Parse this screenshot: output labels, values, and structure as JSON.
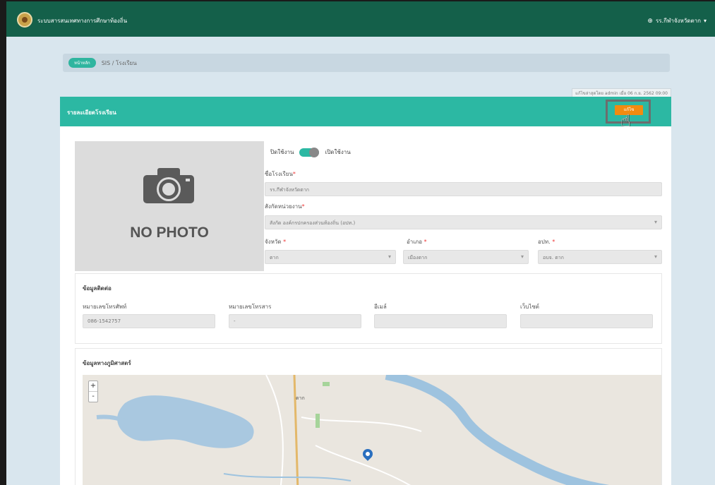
{
  "navbar": {
    "brand": "ระบบสารสนเทศทางการศึกษาท้องถิ่น",
    "user": "รร.กีฬาจังหวัดตาก",
    "caret": "▾",
    "globe": "⊕"
  },
  "breadcrumb": {
    "badge": "หน้าหลัก",
    "path": "SIS / โรงเรียน"
  },
  "last_updated": "แก้ไขล่าสุดโดย admin เมื่อ 06 ก.ย. 2562 09:00",
  "panel": {
    "title": "รายละเอียดโรงเรียน",
    "edit_button": "แก้ไข"
  },
  "photo": {
    "placeholder": "NO PHOTO"
  },
  "toggle": {
    "off_label": "ปิดใช้งาน",
    "on_label": "เปิดใช้งาน",
    "state": "on"
  },
  "form": {
    "school_name_label": "ชื่อโรงเรียน",
    "school_name_value": "รร.กีฬาจังหวัดตาก",
    "agency_label": "สังกัดหน่วยงาน",
    "agency_value": "สังกัด องค์กรปกครองส่วนท้องถิ่น (อปท.)",
    "province_label": "จังหวัด",
    "province_value": "ตาก",
    "district_label": "อำเภอ",
    "district_value": "เมืองตาก",
    "org_label": "อปท.",
    "org_value": "อบจ. ตาก",
    "required_mark": "*"
  },
  "contact": {
    "title": "ข้อมูลติดต่อ",
    "phone_label": "หมายเลขโทรศัพท์",
    "phone_value": "086-1542757",
    "fax_label": "หมายเลขโทรสาร",
    "fax_value": "-",
    "email_label": "อีเมล์",
    "email_value": "",
    "website_label": "เว็บไซต์",
    "website_value": ""
  },
  "map_section": {
    "title": "ข้อมูลทางภูมิศาสตร์",
    "zoom_in": "+",
    "zoom_out": "-",
    "town_label": "ตาก"
  },
  "colors": {
    "navbar": "#14604a",
    "panel_header": "#2cb8a3",
    "edit_button": "#f28b10",
    "page_bg": "#d9e6ee"
  }
}
